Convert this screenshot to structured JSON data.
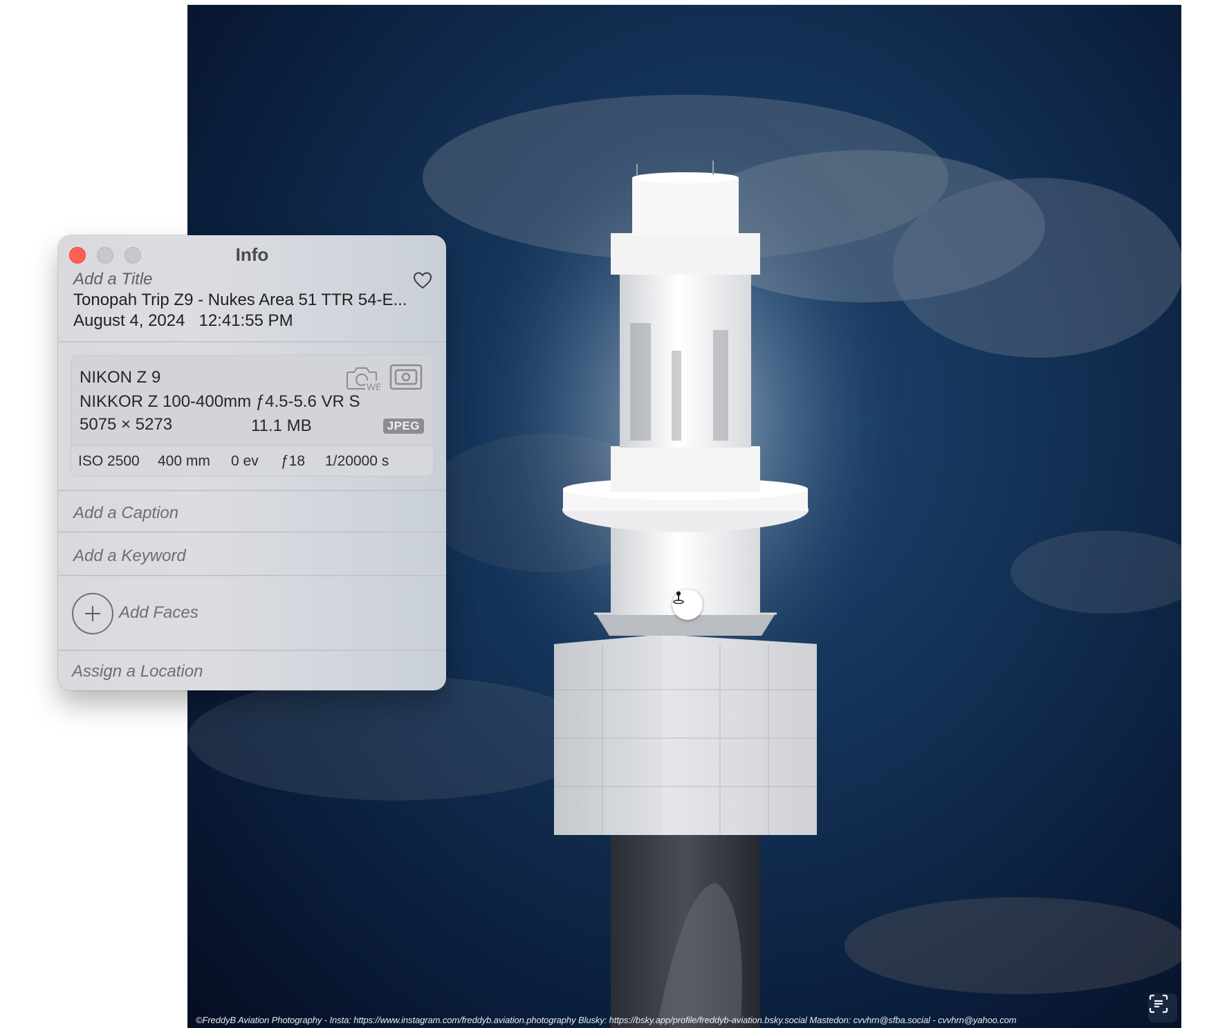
{
  "photo": {
    "credit": "©FreddyB Aviation Photography - Insta: https://www.instagram.com/freddyb.aviation.photography Blusky: https://bsky.app/profile/freddyb-aviation.bsky.social  Mastedon: cvvhrn@sfba.social - cvvhrn@yahoo.com",
    "location_icon": "location-pin-icon",
    "text_scan_icon": "live-text-icon"
  },
  "info_window": {
    "title": "Info",
    "title_placeholder": "Add a Title",
    "filename": "Tonopah Trip Z9 - Nukes Area 51 TTR  54-E...",
    "date": "August 4, 2024",
    "time": "12:41:55 PM",
    "favorite_icon": "heart-icon",
    "camera": {
      "model": "NIKON Z 9",
      "lens": "NIKKOR Z 100-400mm ƒ4.5-5.6 VR S",
      "dimensions": "5075 × 5273",
      "file_size": "11.1 MB",
      "format": "JPEG",
      "wb_label": "WB"
    },
    "exif": {
      "iso": "ISO 2500",
      "focal_length": "400 mm",
      "exposure_bias": "0 ev",
      "aperture": "ƒ18",
      "shutter": "1/20000 s"
    },
    "caption_placeholder": "Add a Caption",
    "keyword_placeholder": "Add a Keyword",
    "faces_label": "Add Faces",
    "location_label": "Assign a Location"
  },
  "colors": {
    "close_button": "#ff5f57",
    "sky_dark": "#0b1f3d",
    "tower": "#f2f2f2"
  }
}
